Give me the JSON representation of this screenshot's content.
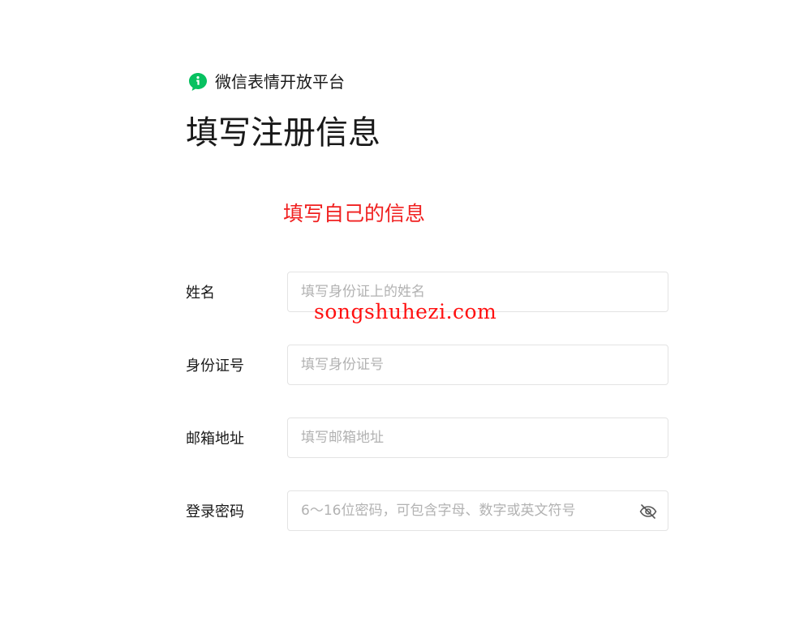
{
  "brand": {
    "name": "微信表情开放平台",
    "logo_icon": "wechat-sticker-logo-icon",
    "logo_color": "#07c160"
  },
  "page": {
    "title": "填写注册信息"
  },
  "annotation": {
    "text": "填写自己的信息",
    "color": "#f02020"
  },
  "watermark": {
    "text": "songshuhezi.com",
    "color": "#ff1010"
  },
  "form": {
    "name": {
      "label": "姓名",
      "value": "",
      "placeholder": "填写身份证上的姓名"
    },
    "id_number": {
      "label": "身份证号",
      "value": "",
      "placeholder": "填写身份证号"
    },
    "email": {
      "label": "邮箱地址",
      "value": "",
      "placeholder": "填写邮箱地址"
    },
    "password": {
      "label": "登录密码",
      "value": "",
      "placeholder": "6～16位密码，可包含字母、数字或英文符号",
      "toggle_icon": "eye-slash-icon"
    }
  }
}
